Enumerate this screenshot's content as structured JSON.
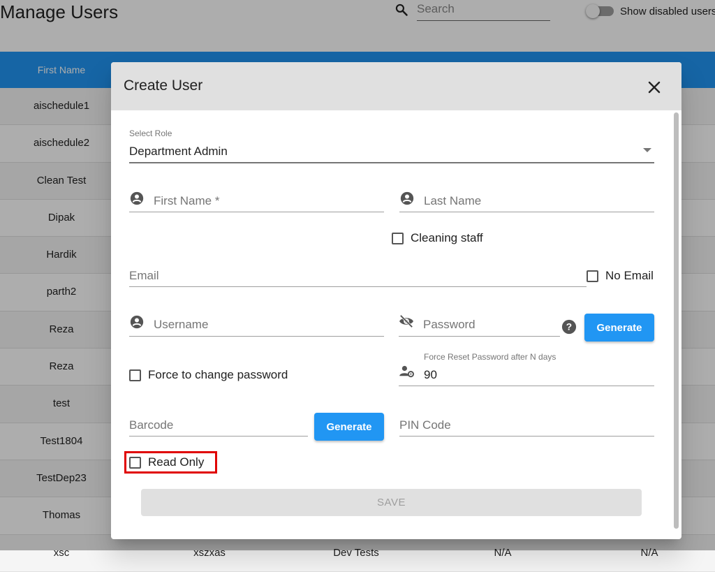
{
  "page": {
    "title": "Manage Users",
    "search_placeholder": "Search",
    "toggle_label": "Show disabled users"
  },
  "table": {
    "columns": [
      "First Name"
    ],
    "rows": [
      {
        "first_name": "aischedule1"
      },
      {
        "first_name": "aischedule2"
      },
      {
        "first_name": "Clean Test"
      },
      {
        "first_name": "Dipak"
      },
      {
        "first_name": "Hardik"
      },
      {
        "first_name": "parth2"
      },
      {
        "first_name": "Reza"
      },
      {
        "first_name": "Reza"
      },
      {
        "first_name": "test"
      },
      {
        "first_name": "Test1804"
      },
      {
        "first_name": "TestDep23"
      },
      {
        "first_name": "Thomas"
      },
      {
        "first_name": "xsc",
        "col2": "xszxas",
        "col3": "Dev Tests",
        "col4": "N/A",
        "col5": "N/A"
      }
    ]
  },
  "dialog": {
    "title": "Create User",
    "role": {
      "label": "Select Role",
      "value": "Department Admin"
    },
    "first_name": {
      "placeholder": "First Name *"
    },
    "last_name": {
      "placeholder": "Last Name"
    },
    "cleaning_staff": {
      "label": "Cleaning staff",
      "checked": false
    },
    "email": {
      "placeholder": "Email"
    },
    "no_email": {
      "label": "No Email",
      "checked": false
    },
    "username": {
      "placeholder": "Username"
    },
    "password": {
      "placeholder": "Password"
    },
    "generate_password_label": "Generate",
    "force_change": {
      "label": "Force to change password",
      "checked": false
    },
    "force_reset": {
      "label": "Force Reset Password after N days",
      "value": "90"
    },
    "barcode": {
      "placeholder": "Barcode"
    },
    "generate_barcode_label": "Generate",
    "pin": {
      "placeholder": "PIN Code"
    },
    "read_only": {
      "label": "Read Only",
      "checked": false
    },
    "save_label": "SAVE"
  },
  "colors": {
    "accent": "#2196f3",
    "highlight": "#e00000"
  },
  "icons": [
    "search-icon",
    "close-icon",
    "person-icon",
    "visibility-off-icon",
    "help-icon",
    "user-cog-icon",
    "dropdown-arrow-icon"
  ]
}
